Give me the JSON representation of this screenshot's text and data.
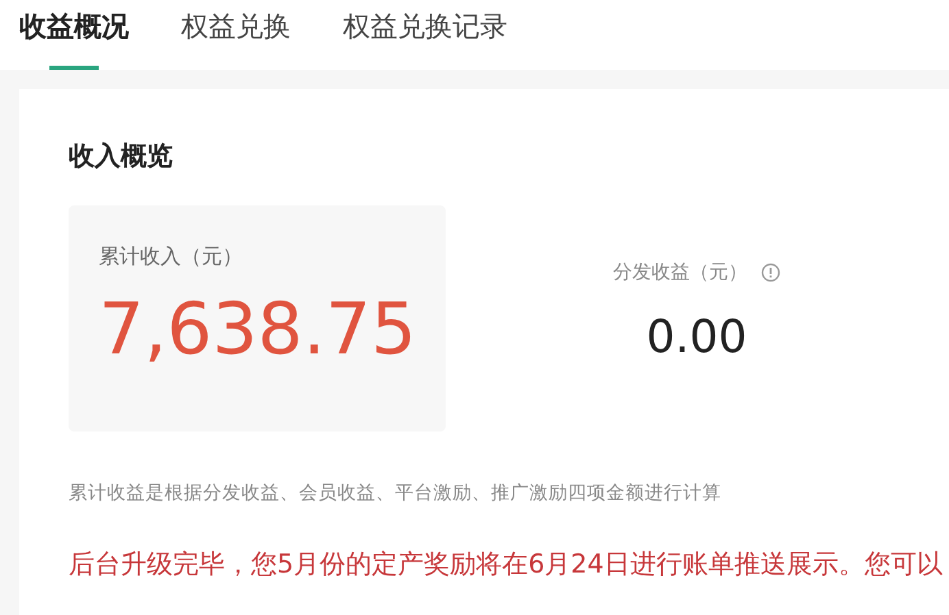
{
  "tabs": [
    {
      "label": "收益概况",
      "selected": true
    },
    {
      "label": "权益兑换",
      "selected": false
    },
    {
      "label": "权益兑换记录",
      "selected": false
    }
  ],
  "overview": {
    "title": "收入概览",
    "total": {
      "label": "累计收入（元）",
      "value": "7,638.75"
    },
    "distribution": {
      "label": "分发收益（元）",
      "value": "0.00"
    },
    "note": "累计收益是根据分发收益、会员收益、平台激励、推广激励四项金额进行计算",
    "notice": "后台升级完毕，您5月份的定产奖励将在6月24日进行账单推送展示。您可以"
  }
}
